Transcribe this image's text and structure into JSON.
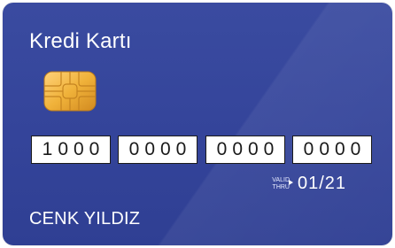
{
  "card": {
    "title": "Kredi Kartı",
    "number_groups": [
      "1000",
      "0000",
      "0000",
      "0000"
    ],
    "valid_thru_label_top": "VALID",
    "valid_thru_label_bottom": "THRU",
    "expiry": "01/21",
    "holder_name": "CENK YILDIZ",
    "colors": {
      "card_background": "#34449a",
      "text": "#ffffff",
      "chip_gold": "#f0b23a",
      "number_box": "#ffffff"
    },
    "icons": {
      "chip": "chip-icon",
      "arrow": "triangle-right-icon"
    }
  }
}
